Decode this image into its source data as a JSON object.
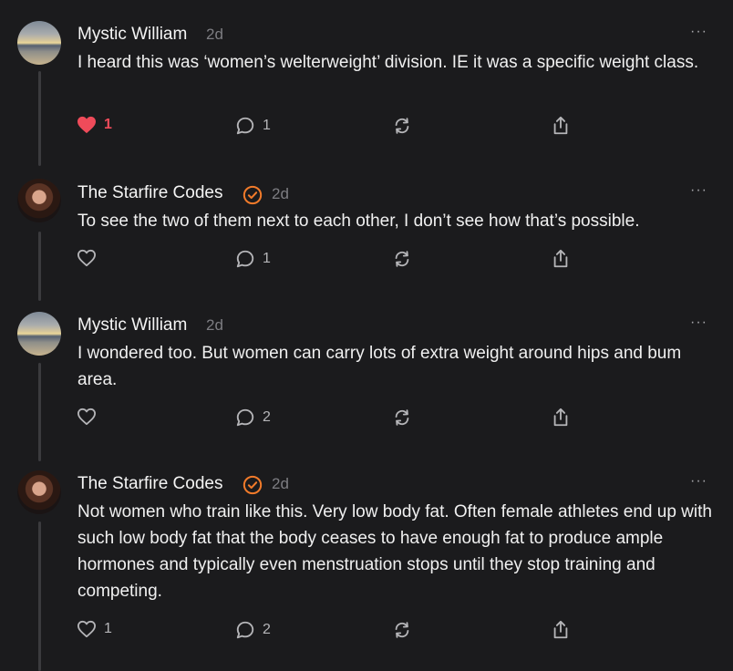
{
  "posts": [
    {
      "author": "Mystic William",
      "time": "2d",
      "verified": false,
      "text": "I heard this was ‘women’s welterweight’ division. IE it was a specific weight class.",
      "likes": "1",
      "liked": true,
      "replies": "1",
      "more": "···"
    },
    {
      "author": "The Starfire Codes",
      "time": "2d",
      "verified": true,
      "text": "To see the two of them next to each other, I don’t see how that’s possible.",
      "likes": "",
      "liked": false,
      "replies": "1",
      "more": "···"
    },
    {
      "author": "Mystic William",
      "time": "2d",
      "verified": false,
      "text": "I wondered too. But women can carry lots of extra weight around hips and bum area.",
      "likes": "",
      "liked": false,
      "replies": "2",
      "more": "···"
    },
    {
      "author": "The Starfire Codes",
      "time": "2d",
      "verified": true,
      "text": "Not women who train like this. Very low body fat. Often female athletes end up with such low body fat that the body ceases to have enough fat to produce ample hormones and typically even menstruation stops until they stop training and competing.",
      "likes": "1",
      "liked": false,
      "replies": "2",
      "more": "···"
    }
  ],
  "colors": {
    "background": "#1b1b1d",
    "like_active": "#ef4b5a",
    "verified": "#f07a2a"
  },
  "icons": [
    "heart-icon",
    "comment-icon",
    "repost-icon",
    "share-icon",
    "verified-badge-icon",
    "more-icon"
  ]
}
